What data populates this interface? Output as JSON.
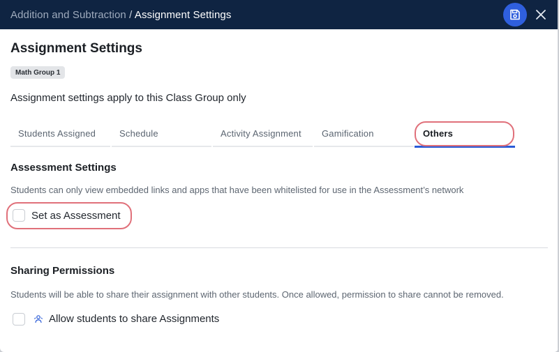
{
  "header": {
    "breadcrumb_parent": "Addition and Subtraction",
    "breadcrumb_separator": " / ",
    "breadcrumb_current": "Assignment Settings",
    "save_icon": "floppy-disk-icon",
    "close_icon": "close-icon"
  },
  "page": {
    "title": "Assignment Settings",
    "group_badge": "Math Group 1",
    "subtitle": "Assignment settings apply to this Class Group only"
  },
  "tabs": [
    {
      "label": "Students Assigned",
      "active": false
    },
    {
      "label": "Schedule",
      "active": false
    },
    {
      "label": "Activity Assignment",
      "active": false
    },
    {
      "label": "Gamification",
      "active": false
    },
    {
      "label": "Others",
      "active": true
    }
  ],
  "assessment": {
    "title": "Assessment Settings",
    "description": "Students can only view embedded links and apps that have been whitelisted for use in the Assessment’s network",
    "checkbox_label": "Set as Assessment",
    "checked": false
  },
  "sharing": {
    "title": "Sharing Permissions",
    "description": "Students will be able to share their assignment with other students. Once allowed, permission to share cannot be removed.",
    "checkbox_label": "Allow students to share Assignments",
    "checked": false,
    "icon": "share-users-icon"
  },
  "colors": {
    "header_bg": "#0f2442",
    "accent": "#2a5bd7",
    "highlight_ring": "#e0707a"
  }
}
